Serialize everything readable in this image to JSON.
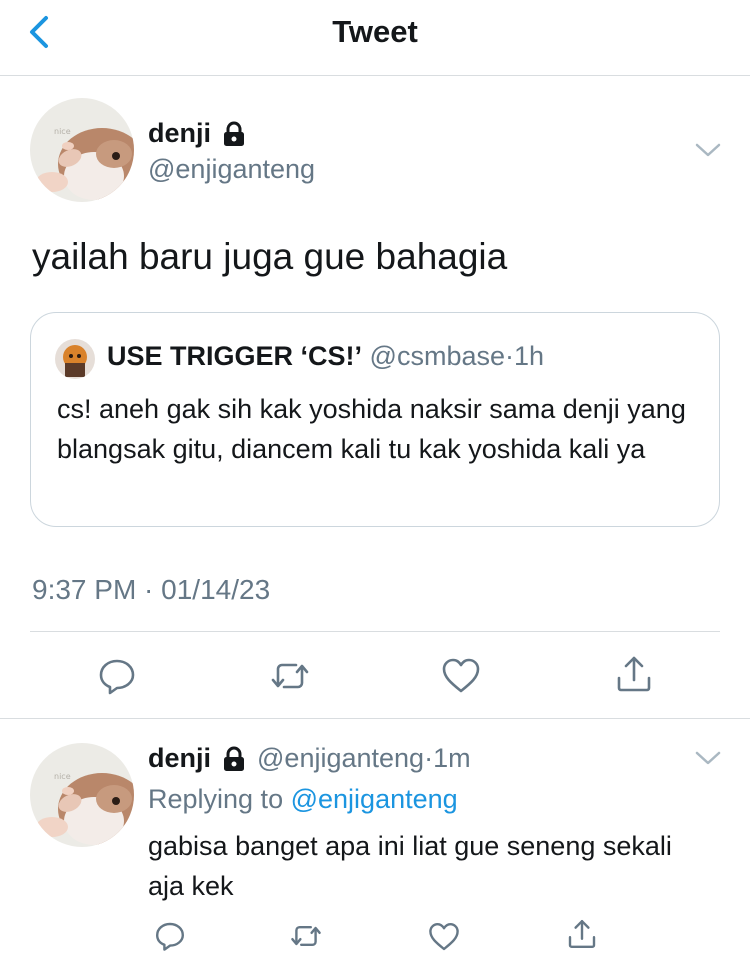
{
  "header": {
    "title": "Tweet"
  },
  "main_tweet": {
    "display_name": "denji",
    "handle": "@enjiganteng",
    "avatar_caption": "nice",
    "text": "yailah baru juga gue bahagia",
    "quote": {
      "display_name": "USE TRIGGER ‘CS!’",
      "handle": "@csmbase",
      "separator": "·",
      "time": "1h",
      "text": "cs! aneh gak sih kak yoshida naksir sama denji yang blangsak gitu, diancem kali tu kak yoshida kali ya"
    },
    "timestamp": "9:37 PM · 01/14/23",
    "actions": [
      "reply-icon",
      "retweet-icon",
      "like-icon",
      "share-icon"
    ]
  },
  "reply_tweet": {
    "display_name": "denji",
    "handle": "@enjiganteng",
    "separator": "·",
    "time": "1m",
    "avatar_caption": "nice",
    "replying_prefix": "Replying to",
    "replying_to": "@enjiganteng",
    "text": "gabisa banget apa ini liat gue seneng sekali aja kek",
    "actions": [
      "reply-icon",
      "retweet-icon",
      "like-icon",
      "share-icon"
    ]
  },
  "colors": {
    "accent": "#1b95e0",
    "text": "#14171a",
    "secondary": "#657786",
    "divider": "#d9dde0"
  }
}
